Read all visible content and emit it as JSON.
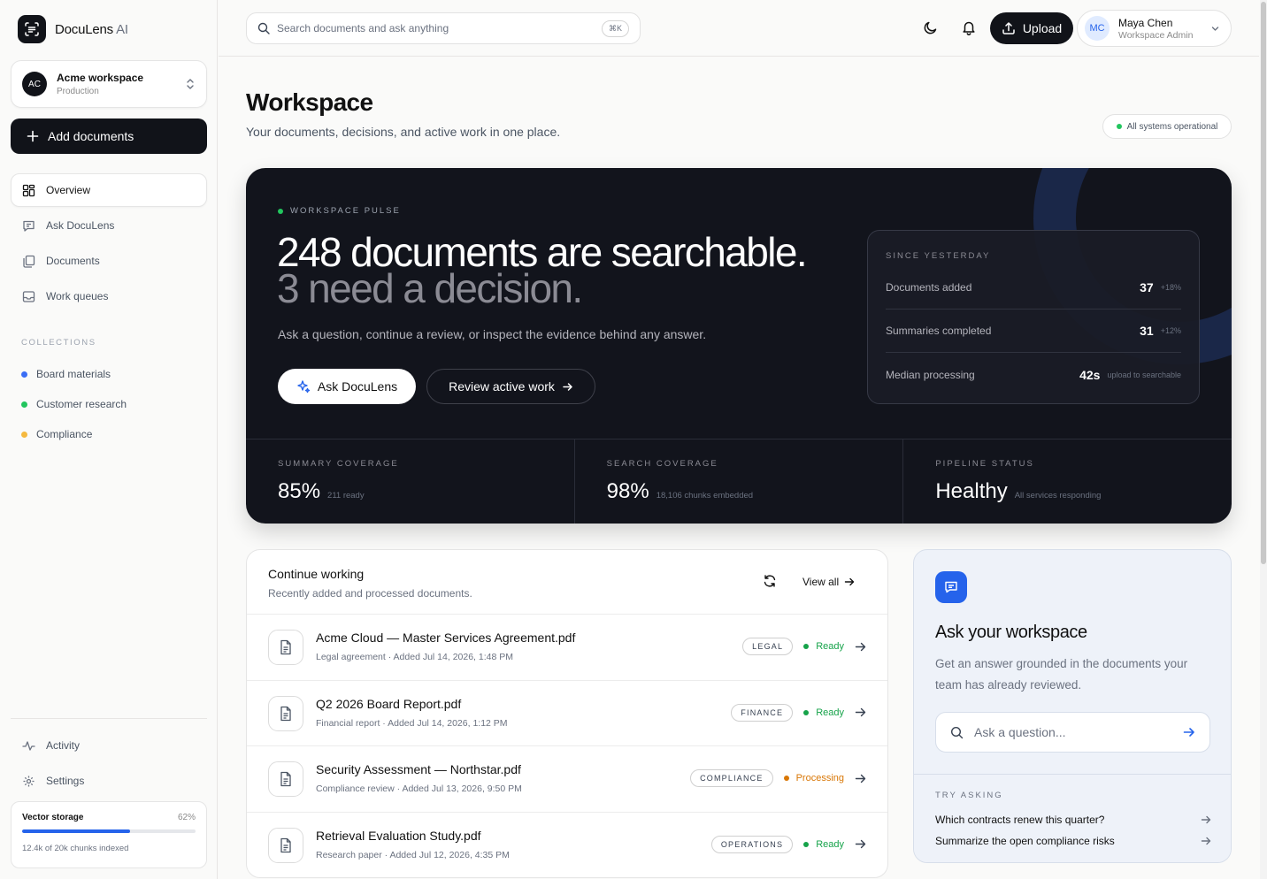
{
  "brand": {
    "name": "DocuLens",
    "suffix": "AI"
  },
  "workspace": {
    "initials": "AC",
    "name": "Acme workspace",
    "env": "Production"
  },
  "sidebar": {
    "add_label": "Add documents",
    "nav": [
      {
        "label": "Overview",
        "icon": "grid-icon"
      },
      {
        "label": "Ask DocuLens",
        "icon": "chat-icon"
      },
      {
        "label": "Documents",
        "icon": "documents-icon"
      },
      {
        "label": "Work queues",
        "icon": "inbox-icon"
      }
    ],
    "collections_label": "COLLECTIONS",
    "collections": [
      {
        "label": "Board materials",
        "color": "#3b6ef5"
      },
      {
        "label": "Customer research",
        "color": "#22c55e"
      },
      {
        "label": "Compliance",
        "color": "#f5b940"
      }
    ],
    "bottom_nav": [
      {
        "label": "Activity",
        "icon": "activity-icon"
      },
      {
        "label": "Settings",
        "icon": "gear-icon"
      }
    ],
    "storage": {
      "title": "Vector storage",
      "percent_text": "62%",
      "fill": 0.62,
      "note": "12.4k of 20k chunks indexed"
    }
  },
  "topbar": {
    "search_placeholder": "Search documents and ask anything",
    "shortcut": "⌘K",
    "upload_label": "Upload",
    "user": {
      "initials": "MC",
      "name": "Maya Chen",
      "role": "Workspace Admin"
    }
  },
  "page": {
    "title": "Workspace",
    "subtitle": "Your documents, decisions, and active work in one place.",
    "status": "All systems operational"
  },
  "hero": {
    "label": "WORKSPACE PULSE",
    "headline": "248 documents are searchable.",
    "subheadline": "3 need a decision.",
    "description": "Ask a question, continue a review, or inspect the evidence behind any answer.",
    "primary_cta": "Ask DocuLens",
    "secondary_cta": "Review active work",
    "since": {
      "label": "SINCE YESTERDAY",
      "rows": [
        {
          "label": "Documents added",
          "value": "37",
          "delta": "+18%"
        },
        {
          "label": "Summaries completed",
          "value": "31",
          "delta": "+12%"
        },
        {
          "label": "Median processing",
          "value": "42s",
          "delta": "upload to searchable"
        }
      ]
    },
    "stats": [
      {
        "label": "SUMMARY COVERAGE",
        "value": "85%",
        "note": "211 ready"
      },
      {
        "label": "SEARCH COVERAGE",
        "value": "98%",
        "note": "18,106 chunks embedded"
      },
      {
        "label": "PIPELINE STATUS",
        "value": "Healthy",
        "note": "All services responding"
      }
    ]
  },
  "continue_working": {
    "title": "Continue working",
    "subtitle": "Recently added and processed documents.",
    "view_all": "View all",
    "docs": [
      {
        "title": "Acme Cloud — Master Services Agreement.pdf",
        "meta": "Legal agreement · Added Jul 14, 2026, 1:48 PM",
        "tag": "LEGAL",
        "status": "Ready",
        "status_color": "#16a34a"
      },
      {
        "title": "Q2 2026 Board Report.pdf",
        "meta": "Financial report · Added Jul 14, 2026, 1:12 PM",
        "tag": "FINANCE",
        "status": "Ready",
        "status_color": "#16a34a"
      },
      {
        "title": "Security Assessment — Northstar.pdf",
        "meta": "Compliance review · Added Jul 13, 2026, 9:50 PM",
        "tag": "COMPLIANCE",
        "status": "Processing",
        "status_color": "#d97706"
      },
      {
        "title": "Retrieval Evaluation Study.pdf",
        "meta": "Research paper · Added Jul 12, 2026, 4:35 PM",
        "tag": "OPERATIONS",
        "status": "Ready",
        "status_color": "#16a34a"
      }
    ]
  },
  "ask_panel": {
    "title": "Ask your workspace",
    "description": "Get an answer grounded in the documents your team has already reviewed.",
    "placeholder": "Ask a question...",
    "try_label": "TRY ASKING",
    "suggestions": [
      "Which contracts renew this quarter?",
      "Summarize the open compliance risks"
    ]
  },
  "colors": {
    "accent": "#2563eb",
    "dark": "#12141c",
    "ready": "#16a34a",
    "processing": "#d97706"
  }
}
